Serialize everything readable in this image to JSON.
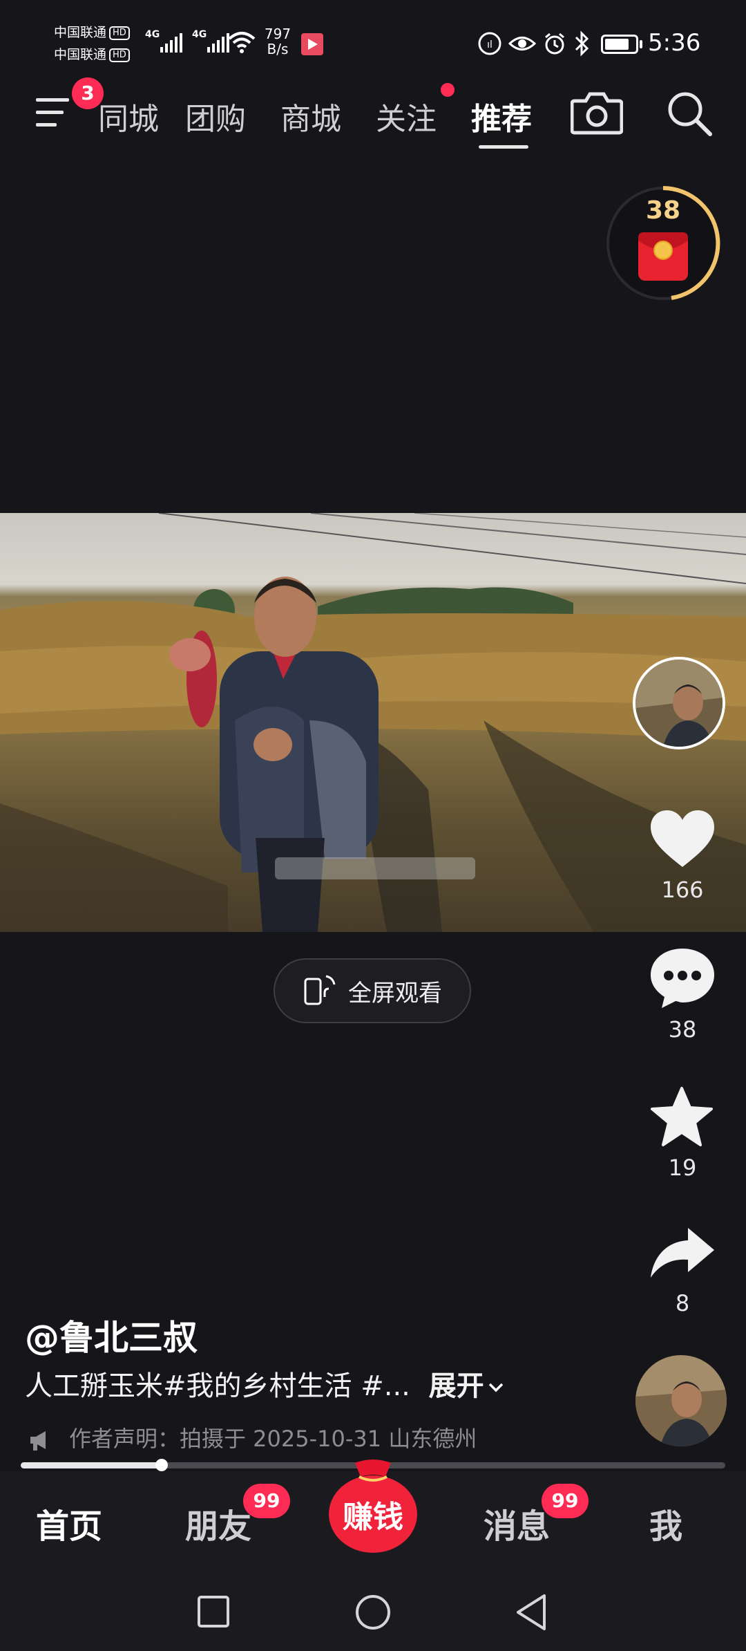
{
  "status_bar": {
    "carrier1": "中国联通",
    "carrier2": "中国联通",
    "hd": "HD",
    "net1": "4G",
    "net2": "4G",
    "speed_value": "797",
    "speed_unit": "B/s",
    "time": "5:36",
    "battery_level": 0.8
  },
  "top_nav": {
    "menu_badge": "3",
    "tabs": [
      "同城",
      "团购",
      "商城",
      "关注",
      "推荐"
    ],
    "active_tab": "推荐"
  },
  "reward_widget": {
    "count": "38"
  },
  "video": {
    "fullscreen_label": "全屏观看"
  },
  "side_actions": {
    "likes": "166",
    "comments": "38",
    "favorites": "19",
    "shares": "8"
  },
  "post": {
    "handle": "@鲁北三叔",
    "description": "人工掰玉米#我的乡村生活 #...",
    "expand_label": "展开",
    "declaration": "作者声明：拍摄于 2025-10-31 山东德州",
    "progress": 0.2
  },
  "bottom_tabs": {
    "home": "首页",
    "friends": "朋友",
    "friends_badge": "99",
    "earn": "赚钱",
    "messages": "消息",
    "messages_badge": "99",
    "me": "我"
  },
  "colors": {
    "accent": "#fe2c55",
    "background": "#16161a"
  }
}
